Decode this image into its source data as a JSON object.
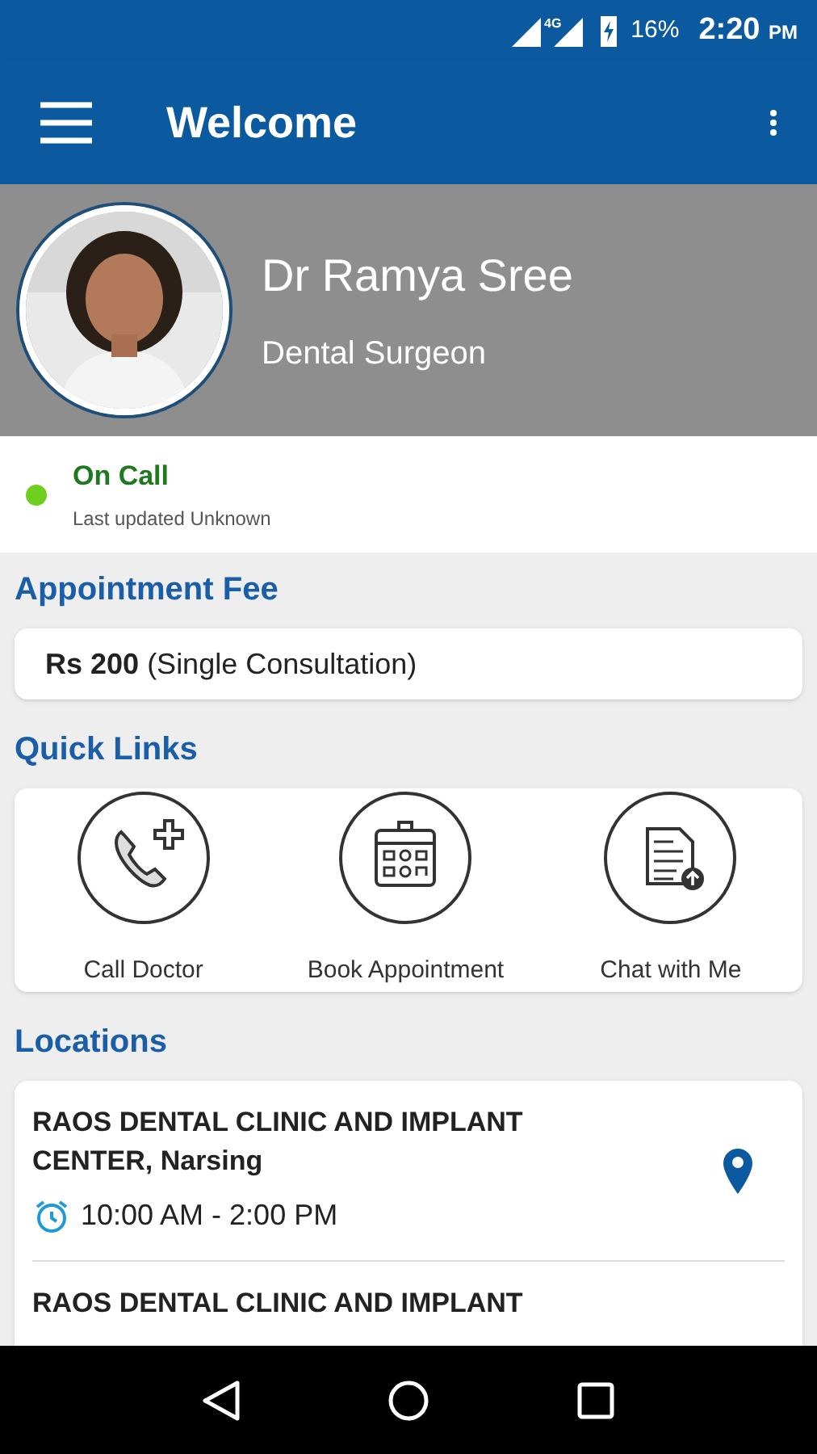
{
  "status_bar": {
    "network": "4G",
    "battery": "16%",
    "time": "2:20",
    "ampm": "PM"
  },
  "app_bar": {
    "title": "Welcome"
  },
  "profile": {
    "name": "Dr Ramya Sree",
    "specialty": "Dental Surgeon"
  },
  "availability": {
    "label": "On Call",
    "on_call": true,
    "updated": "Last updated Unknown"
  },
  "fee": {
    "heading": "Appointment Fee",
    "amount": "Rs 200",
    "note": "(Single Consultation)"
  },
  "quick_links": {
    "heading": "Quick Links",
    "items": [
      {
        "kind": "call",
        "label": "Call Doctor"
      },
      {
        "kind": "calendar",
        "label": "Book Appointment"
      },
      {
        "kind": "document",
        "label": "Chat with Me"
      }
    ]
  },
  "locations": {
    "heading": "Locations",
    "items": [
      {
        "name": "RAOS DENTAL CLINIC AND IMPLANT CENTER, Narsing",
        "hours": "10:00 AM - 2:00 PM"
      },
      {
        "name": "RAOS DENTAL CLINIC AND IMPLANT"
      }
    ]
  }
}
